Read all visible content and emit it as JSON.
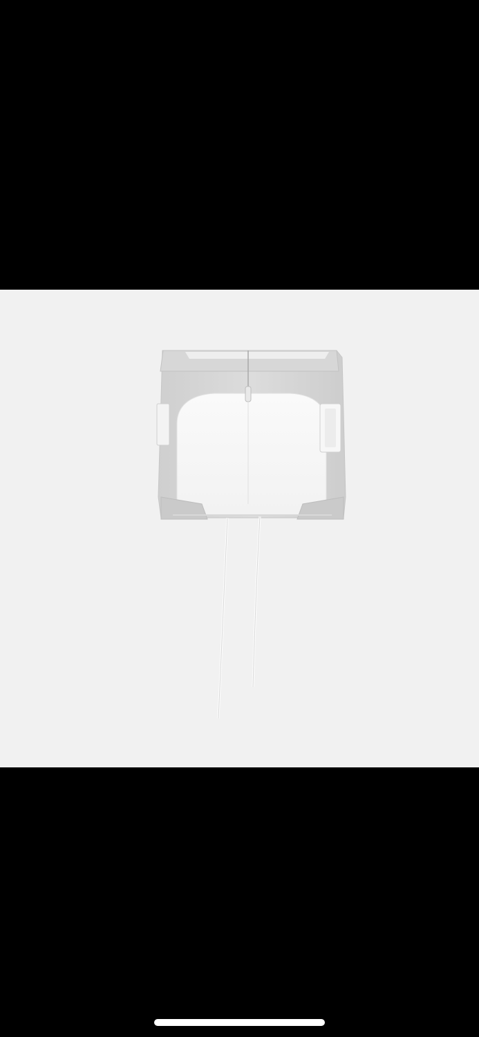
{
  "viewer": {
    "background_color": "#000000",
    "photo_background_color": "#f1f1f1",
    "home_indicator_color": "#ffffff"
  },
  "photo": {
    "subject_icon": "mini-skirt-photo"
  }
}
